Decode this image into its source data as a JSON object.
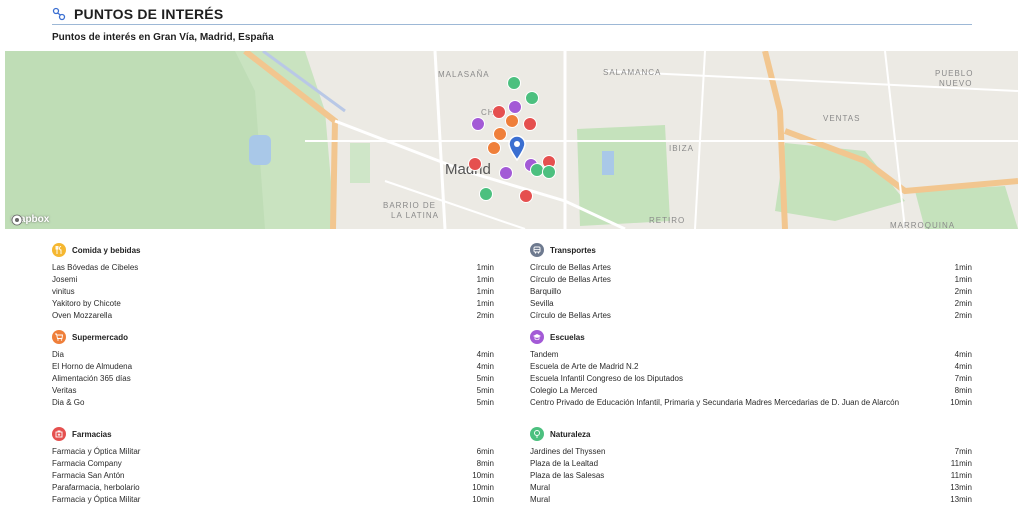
{
  "header": {
    "title": "PUNTOS DE INTERÉS"
  },
  "subtitle": "Puntos de interés en Gran Vía, Madrid, España",
  "map": {
    "city": "Madrid",
    "labels": {
      "malasana": "MALASAÑA",
      "salamanca": "SALAMANCA",
      "pueblo_nuevo_1": "PUEBLO",
      "pueblo_nuevo_2": "NUEVO",
      "ibiza": "IBIZA",
      "ventas": "VENTAS",
      "barrio_1": "BARRIO DE",
      "barrio_2": "LA LATINA",
      "retiro": "RETIRO",
      "marroquina": "MARROQUINA",
      "ch": "CH"
    },
    "brand": "mapbox"
  },
  "colors": {
    "food": "#f5b731",
    "supermarket": "#ef7f3a",
    "pharmacy": "#e5504f",
    "transport": "#6e7a8f",
    "school": "#a35ad6",
    "nature": "#4cc07f",
    "pin": "#3b6fd1"
  },
  "sections": {
    "food": {
      "title": "Comida y bebidas",
      "icon": "fork-knife-icon",
      "items": [
        {
          "name": "Las Bóvedas de Cibeles",
          "time": "1min"
        },
        {
          "name": "Josemi",
          "time": "1min"
        },
        {
          "name": "vinitus",
          "time": "1min"
        },
        {
          "name": "Yakitoro by Chicote",
          "time": "1min"
        },
        {
          "name": "Oven Mozzarella",
          "time": "2min"
        }
      ]
    },
    "supermarket": {
      "title": "Supermercado",
      "icon": "cart-icon",
      "items": [
        {
          "name": "Dia",
          "time": "4min"
        },
        {
          "name": "El Horno de Almudena",
          "time": "4min"
        },
        {
          "name": "Alimentación 365 días",
          "time": "5min"
        },
        {
          "name": "Veritas",
          "time": "5min"
        },
        {
          "name": "Dia & Go",
          "time": "5min"
        }
      ]
    },
    "pharmacy": {
      "title": "Farmacias",
      "icon": "pharmacy-icon",
      "items": [
        {
          "name": "Farmacia y Óptica Militar",
          "time": "6min"
        },
        {
          "name": "Farmacia Company",
          "time": "8min"
        },
        {
          "name": "Farmacia San Antón",
          "time": "10min"
        },
        {
          "name": "Parafarmacia, herbolario",
          "time": "10min"
        },
        {
          "name": "Farmacia y Óptica Militar",
          "time": "10min"
        }
      ]
    },
    "transport": {
      "title": "Transportes",
      "icon": "bus-icon",
      "items": [
        {
          "name": "Círculo de Bellas Artes",
          "time": "1min"
        },
        {
          "name": "Círculo de Bellas Artes",
          "time": "1min"
        },
        {
          "name": "Barquillo",
          "time": "2min"
        },
        {
          "name": "Sevilla",
          "time": "2min"
        },
        {
          "name": "Círculo de Bellas Artes",
          "time": "2min"
        }
      ]
    },
    "school": {
      "title": "Escuelas",
      "icon": "graduation-cap-icon",
      "items": [
        {
          "name": "Tandem",
          "time": "4min"
        },
        {
          "name": "Escuela de Arte de Madrid N.2",
          "time": "4min"
        },
        {
          "name": "Escuela Infantil Congreso de los Diputados",
          "time": "7min"
        },
        {
          "name": "Colegio La Merced",
          "time": "8min"
        },
        {
          "name": "Centro Privado de Educación Infantil, Primaria y Secundaria Madres Mercedarias de D. Juan de Alarcón",
          "time": "10min"
        }
      ]
    },
    "nature": {
      "title": "Naturaleza",
      "icon": "tree-icon",
      "items": [
        {
          "name": "Jardines del Thyssen",
          "time": "7min"
        },
        {
          "name": "Plaza de la Lealtad",
          "time": "11min"
        },
        {
          "name": "Plaza de las Salesas",
          "time": "11min"
        },
        {
          "name": "Mural",
          "time": "13min"
        },
        {
          "name": "Mural",
          "time": "13min"
        }
      ]
    }
  }
}
